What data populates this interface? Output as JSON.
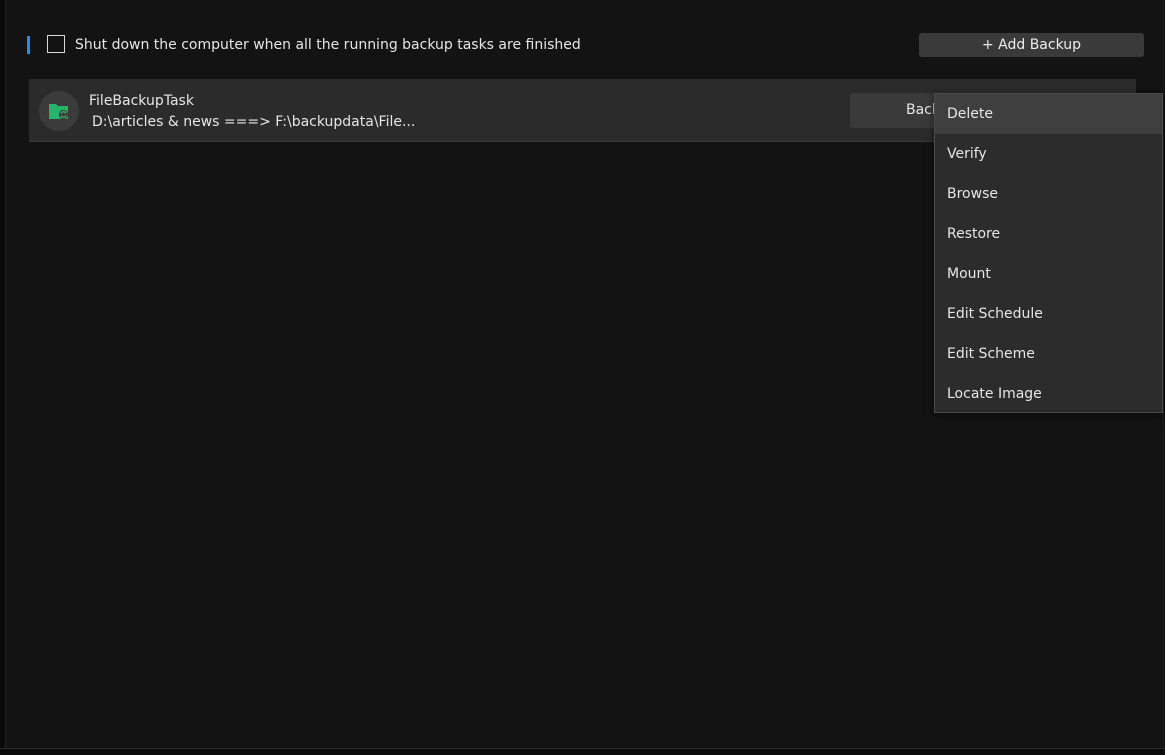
{
  "toolbar": {
    "shutdown_label": "Shut down the computer when all the running backup tasks are finished",
    "shutdown_checked": false,
    "add_backup_label": "+ Add Backup"
  },
  "tasks": [
    {
      "name": "FileBackupTask",
      "path": "D:\\articles & news ===> F:\\backupdata\\File...",
      "icon": "folder-sync-icon",
      "backup_button_label": "Backup Now"
    }
  ],
  "context_menu": {
    "items": [
      {
        "label": "Delete"
      },
      {
        "label": "Verify"
      },
      {
        "label": "Browse"
      },
      {
        "label": "Restore"
      },
      {
        "label": "Mount"
      },
      {
        "label": "Edit Schedule"
      },
      {
        "label": "Edit Scheme"
      },
      {
        "label": "Locate Image"
      }
    ]
  },
  "colors": {
    "accent": "#2b8ae6",
    "folder_icon": "#27b36a",
    "background": "#131313",
    "row_background": "#2b2b2b",
    "menu_background": "#2c2c2c"
  }
}
